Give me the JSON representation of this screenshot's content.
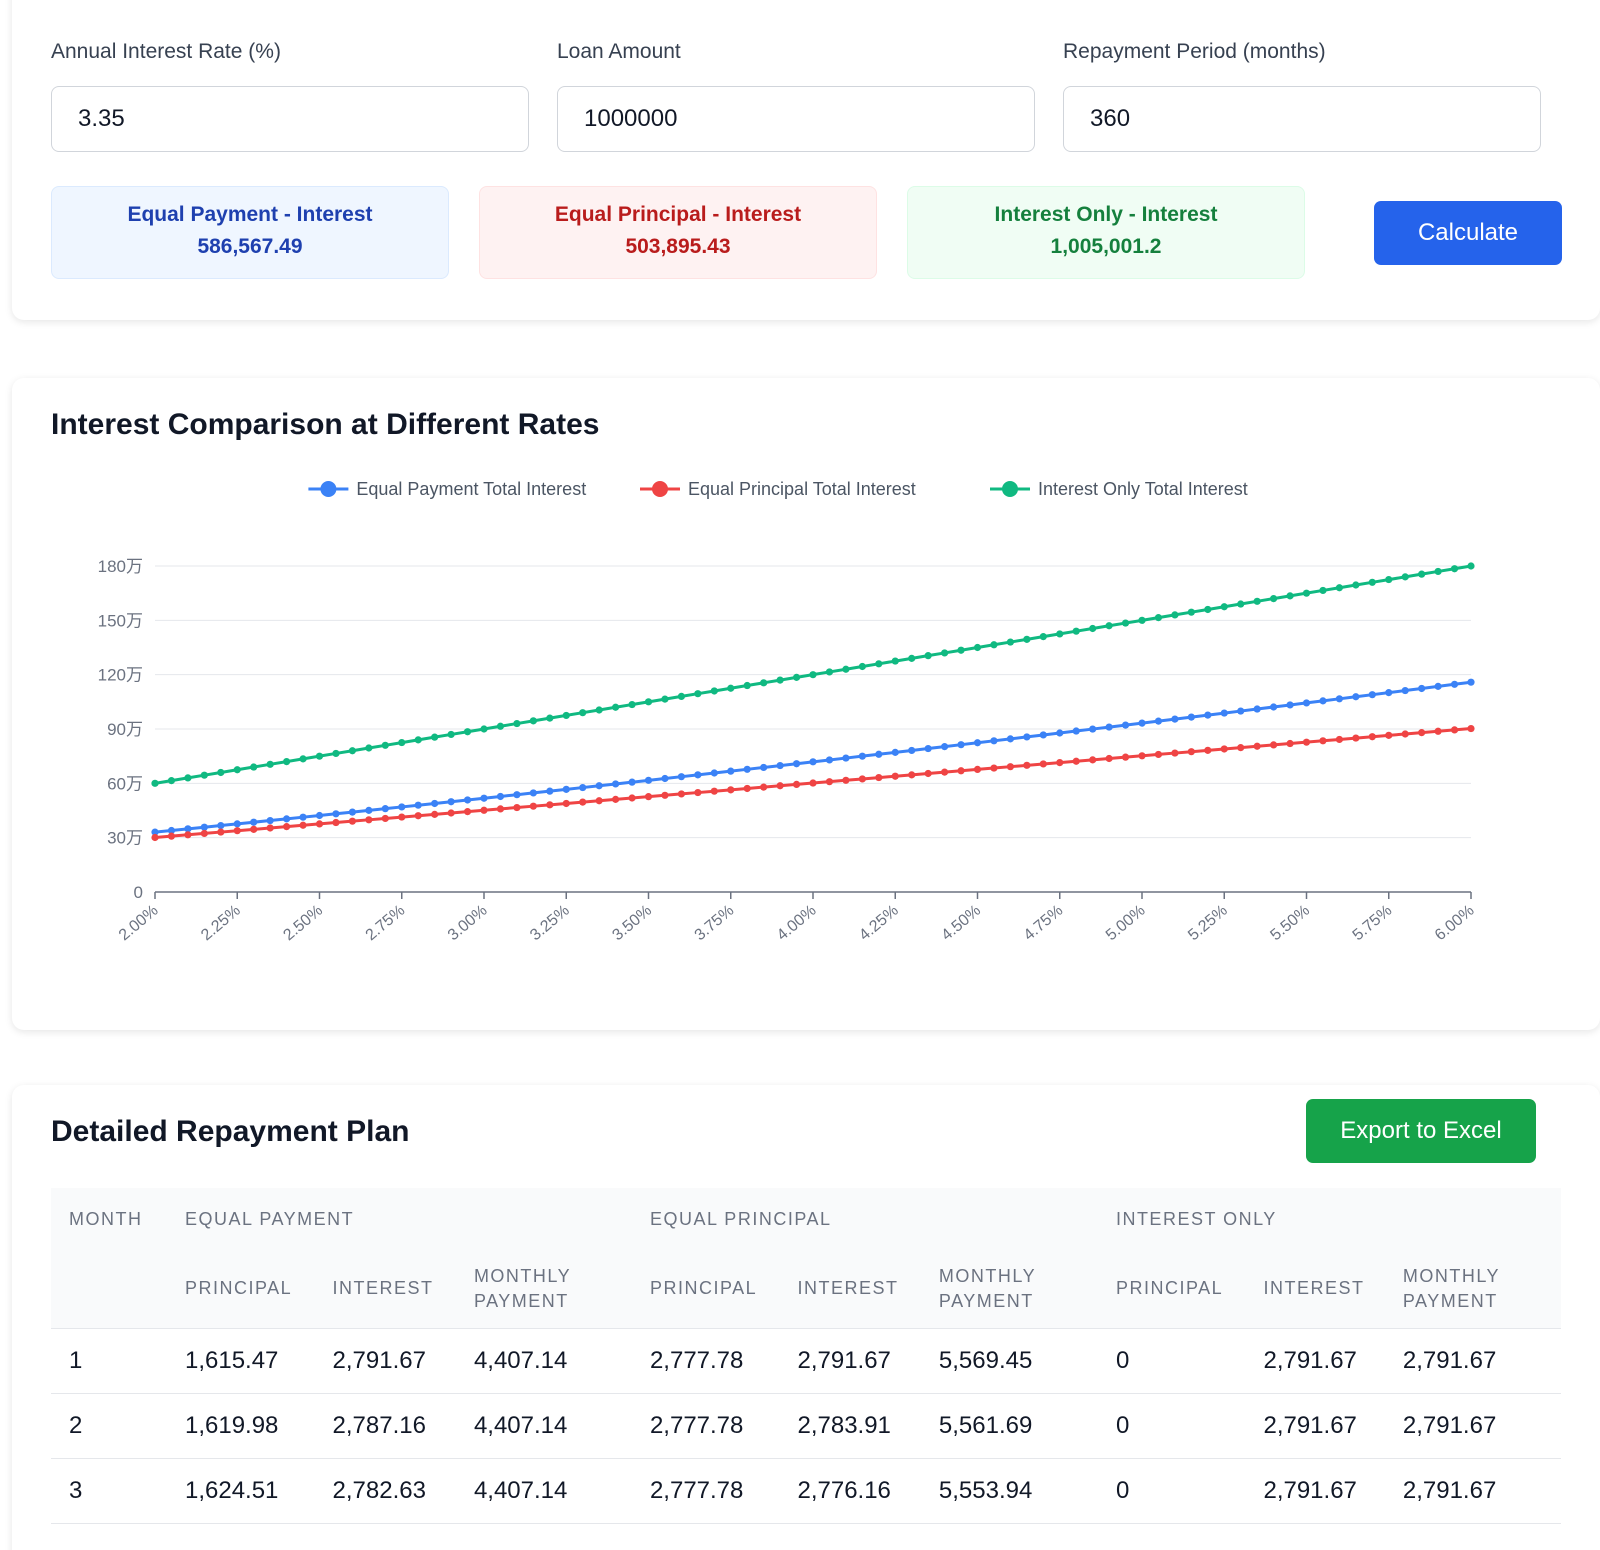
{
  "form": {
    "rate_label": "Annual Interest Rate (%)",
    "rate_value": "3.35",
    "amount_label": "Loan Amount",
    "amount_value": "1000000",
    "period_label": "Repayment Period (months)",
    "period_value": "360",
    "calculate_label": "Calculate"
  },
  "results": {
    "equal_payment": {
      "label": "Equal Payment - Interest",
      "value": "586,567.49",
      "color": "#1e40af"
    },
    "equal_principal": {
      "label": "Equal Principal - Interest",
      "value": "503,895.43",
      "color": "#b91c1c"
    },
    "interest_only": {
      "label": "Interest Only - Interest",
      "value": "1,005,001.2",
      "color": "#15803d"
    }
  },
  "chart": {
    "title": "Interest Comparison at Different Rates"
  },
  "chart_data": {
    "type": "line",
    "title": "Interest Comparison at Different Rates",
    "x_range": [
      2.0,
      6.0
    ],
    "x_step": 0.05,
    "x_tick_labels": [
      "2.00%",
      "2.25%",
      "2.50%",
      "2.75%",
      "3.00%",
      "3.25%",
      "3.50%",
      "3.75%",
      "4.00%",
      "4.25%",
      "4.50%",
      "4.75%",
      "5.00%",
      "5.25%",
      "5.50%",
      "5.75%",
      "6.00%"
    ],
    "y_tick_labels": [
      "0",
      "30万",
      "60万",
      "90万",
      "120万",
      "150万",
      "180万"
    ],
    "ylim": [
      0,
      1800000
    ],
    "grid": true,
    "legend": "top-center",
    "series": [
      {
        "name": "Equal Payment Total Interest",
        "color": "#3b82f6",
        "loan": 1000000,
        "months": 360,
        "method": "equal_payment"
      },
      {
        "name": "Equal Principal Total Interest",
        "color": "#ef4444",
        "loan": 1000000,
        "months": 360,
        "method": "equal_principal"
      },
      {
        "name": "Interest Only Total Interest",
        "color": "#10b981",
        "loan": 1000000,
        "months": 360,
        "method": "interest_only"
      }
    ]
  },
  "table": {
    "title": "Detailed Repayment Plan",
    "export_label": "Export to Excel",
    "group_headers": [
      "Month",
      "Equal Payment",
      "Equal Principal",
      "Interest Only"
    ],
    "sub_headers": [
      "Principal",
      "Interest",
      "Monthly Payment",
      "Principal",
      "Interest",
      "Monthly Payment",
      "Principal",
      "Interest",
      "Monthly Payment"
    ],
    "rows": [
      [
        "1",
        "1,615.47",
        "2,791.67",
        "4,407.14",
        "2,777.78",
        "2,791.67",
        "5,569.45",
        "0",
        "2,791.67",
        "2,791.67"
      ],
      [
        "2",
        "1,619.98",
        "2,787.16",
        "4,407.14",
        "2,777.78",
        "2,783.91",
        "5,561.69",
        "0",
        "2,791.67",
        "2,791.67"
      ],
      [
        "3",
        "1,624.51",
        "2,782.63",
        "4,407.14",
        "2,777.78",
        "2,776.16",
        "5,553.94",
        "0",
        "2,791.67",
        "2,791.67"
      ]
    ]
  }
}
